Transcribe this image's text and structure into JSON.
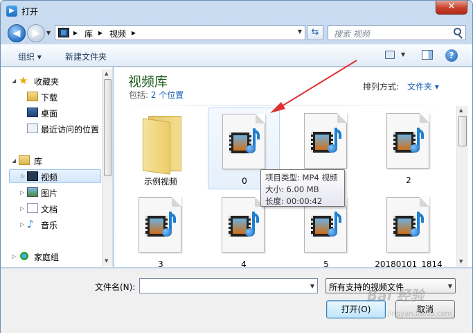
{
  "window": {
    "title": "打开",
    "close_glyph": "✕"
  },
  "nav": {
    "back_glyph": "◀",
    "forward_glyph": "▶",
    "breadcrumb": [
      "库",
      "视频"
    ],
    "crumb_sep": "▸",
    "refresh_glyph": "⇆",
    "search_placeholder": "搜索 视频"
  },
  "toolbar": {
    "organize": "组织 ▾",
    "new_folder": "新建文件夹",
    "help": "?"
  },
  "sidebar": {
    "favorites": {
      "label": "收藏夹",
      "items": [
        "下载",
        "桌面",
        "最近访问的位置"
      ]
    },
    "libraries": {
      "label": "库",
      "items": [
        "视频",
        "图片",
        "文档",
        "音乐"
      ],
      "selected": "视频"
    },
    "homegroup": "家庭组"
  },
  "content": {
    "library_title": "视频库",
    "includes_prefix": "包括: ",
    "includes_link": "2 个位置",
    "sort_label": "排列方式:",
    "sort_value": "文件夹 ▾",
    "items": [
      {
        "label": "示例视频",
        "type": "folder"
      },
      {
        "label": "0",
        "type": "video",
        "hovered": true
      },
      {
        "label": "1",
        "type": "video"
      },
      {
        "label": "2",
        "type": "video"
      },
      {
        "label": "3",
        "type": "video"
      },
      {
        "label": "4",
        "type": "video"
      },
      {
        "label": "5",
        "type": "video"
      },
      {
        "label": "20180101_1814",
        "type": "video"
      }
    ]
  },
  "tooltip": {
    "line1": "项目类型: MP4 视频",
    "line2": "大小: 6.00 MB",
    "line3": "长度: 00:00:42"
  },
  "bottom": {
    "filename_label": "文件名(N):",
    "filename_value": "",
    "filter_value": "所有支持的视频文件",
    "open_label": "打开(O)",
    "cancel_label": "取消"
  },
  "watermark": {
    "main": "Bai 经验",
    "sub": "jingyan.baidu.com"
  },
  "colors": {
    "accent": "#1a5fb4",
    "library_title": "#1e5a1e",
    "arrow": "#e03030"
  }
}
